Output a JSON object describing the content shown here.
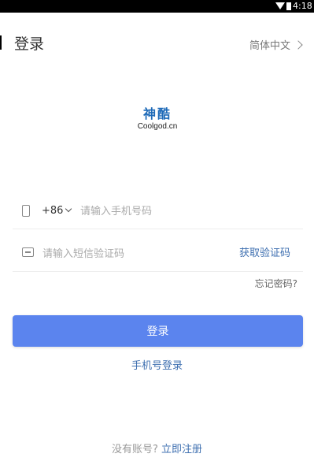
{
  "status_bar": {
    "time": "4:18"
  },
  "header": {
    "title": "登录",
    "language": "简体中文"
  },
  "logo": {
    "cn": "神酷",
    "en": "Coolgod.cn"
  },
  "form": {
    "country_code": "+86",
    "phone_placeholder": "请输入手机号码",
    "code_placeholder": "请输入短信验证码",
    "get_code": "获取验证码",
    "forgot": "忘记密码?",
    "login": "登录"
  },
  "alt_login": "手机号登录",
  "footer": {
    "question": "没有账号?",
    "register": "立即注册"
  },
  "colors": {
    "accent": "#5b84ee",
    "link": "#3e6fb0"
  },
  "icons": {
    "phone": "phone-icon",
    "message": "message-icon",
    "wifi": "wifi-icon",
    "battery": "battery-icon"
  }
}
